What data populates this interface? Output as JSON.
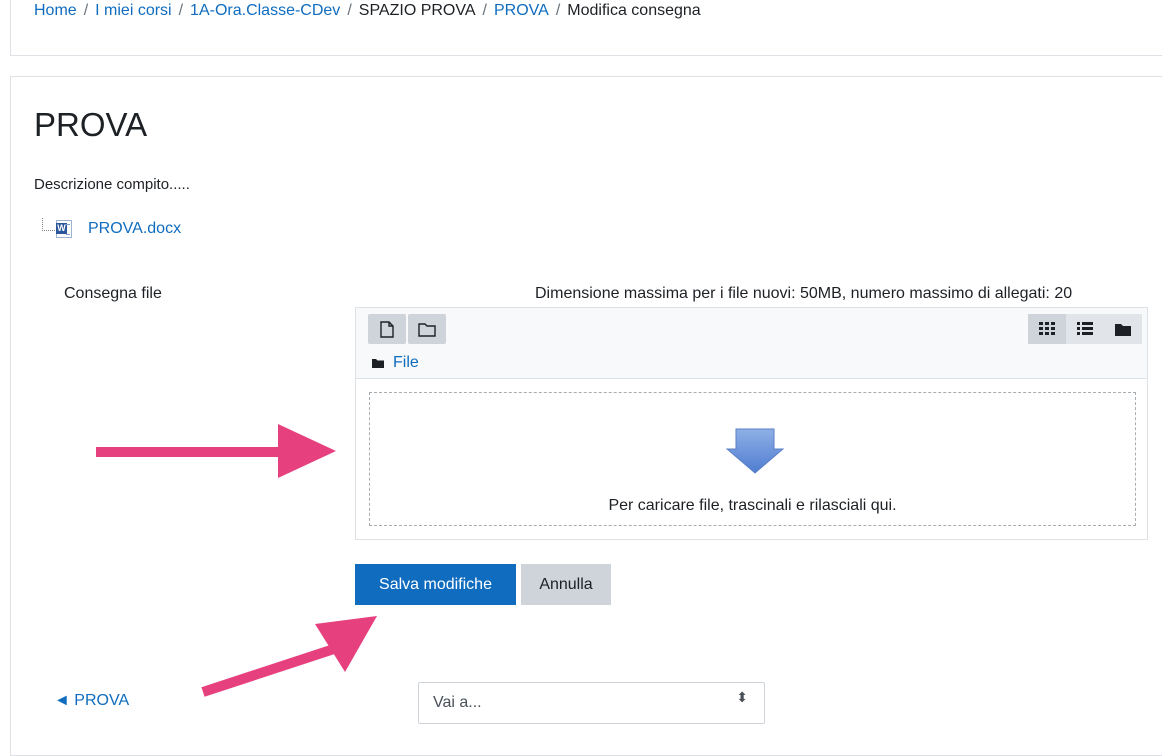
{
  "breadcrumb": {
    "items": [
      "Home",
      "I miei corsi",
      "1A-Ora.Classe-CDev",
      "SPAZIO PROVA",
      "PROVA",
      "Modifica consegna"
    ],
    "separator": "/"
  },
  "page": {
    "title": "PROVA",
    "description": "Descrizione compito.....",
    "attachment": "PROVA.docx"
  },
  "submission": {
    "field_label": "Consegna file",
    "limits": "Dimensione massima per i file nuovi: 50MB, numero massimo di allegati: 20",
    "path_label": "File",
    "drop_message": "Per caricare file, trascinali e rilasciali qui."
  },
  "buttons": {
    "save": "Salva modifiche",
    "cancel": "Annulla"
  },
  "footer": {
    "prev_link": "◄ PROVA",
    "jump_value": "Vai a...",
    "jump_caret": "⬍"
  },
  "colors": {
    "link": "#0f6cbf",
    "primary": "#0f6cbf",
    "annotation_arrow": "#e6407f"
  },
  "icons": [
    "new-file-icon",
    "new-folder-icon",
    "grid-view-icon",
    "list-view-icon",
    "tree-view-icon",
    "folder-icon",
    "upload-arrow-icon",
    "word-doc-icon"
  ]
}
